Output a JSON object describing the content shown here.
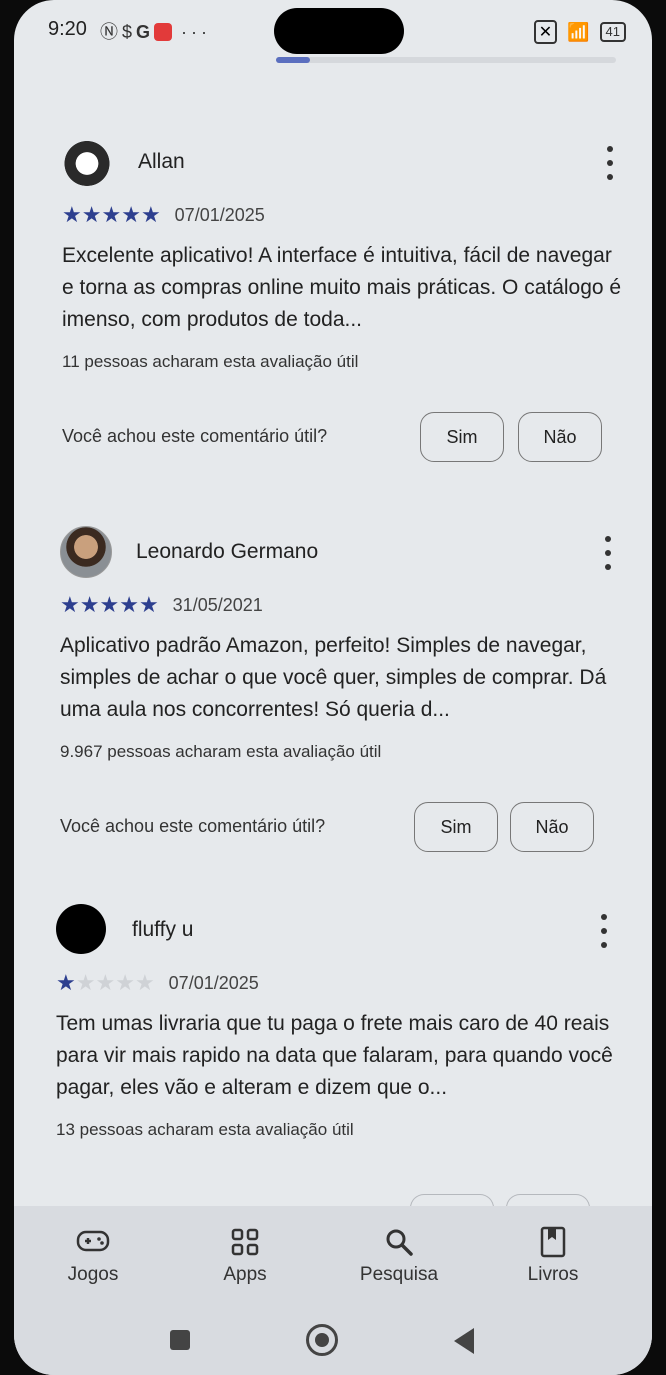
{
  "status_bar": {
    "time": "9:20",
    "icons_left": [
      "nfc-icon",
      "s-icon",
      "google-icon",
      "mail-icon",
      "more-icon"
    ],
    "battery": "41",
    "progress": 0.1
  },
  "reviews": [
    {
      "name": "Allan",
      "rating": 5,
      "date": "07/01/2025",
      "text": "Excelente aplicativo! A interface é intuitiva, fácil de navegar e torna as compras online muito mais práticas. O catálogo é imenso, com produtos de toda...",
      "helpful_count": "11 pessoas acharam esta avaliação útil",
      "helpful_question": "Você achou este comentário útil?",
      "yes": "Sim",
      "no": "Não"
    },
    {
      "name": "Leonardo Germano",
      "rating": 5,
      "date": "31/05/2021",
      "text": "Aplicativo padrão Amazon, perfeito! Simples de navegar, simples de achar o que você quer, simples de comprar. Dá uma aula nos concorrentes! Só queria d...",
      "helpful_count": "9.967 pessoas acharam esta avaliação útil",
      "helpful_question": "Você achou este comentário útil?",
      "yes": "Sim",
      "no": "Não"
    },
    {
      "name": "fluffy u",
      "rating": 1,
      "date": "07/01/2025",
      "text": "Tem umas livraria que tu paga o frete mais caro de 40 reais para vir mais rapido na data que falaram, para quando você pagar, eles vão e alteram e dizem que o...",
      "helpful_count": "13 pessoas acharam esta avaliação útil"
    }
  ],
  "bottom_nav": [
    {
      "label": "Jogos",
      "icon": "gamepad-icon"
    },
    {
      "label": "Apps",
      "icon": "apps-grid-icon"
    },
    {
      "label": "Pesquisa",
      "icon": "search-icon"
    },
    {
      "label": "Livros",
      "icon": "book-icon"
    }
  ],
  "colors": {
    "star": "#2d3f8f",
    "background": "#e6e9ec",
    "nav": "#d8dbe0"
  }
}
